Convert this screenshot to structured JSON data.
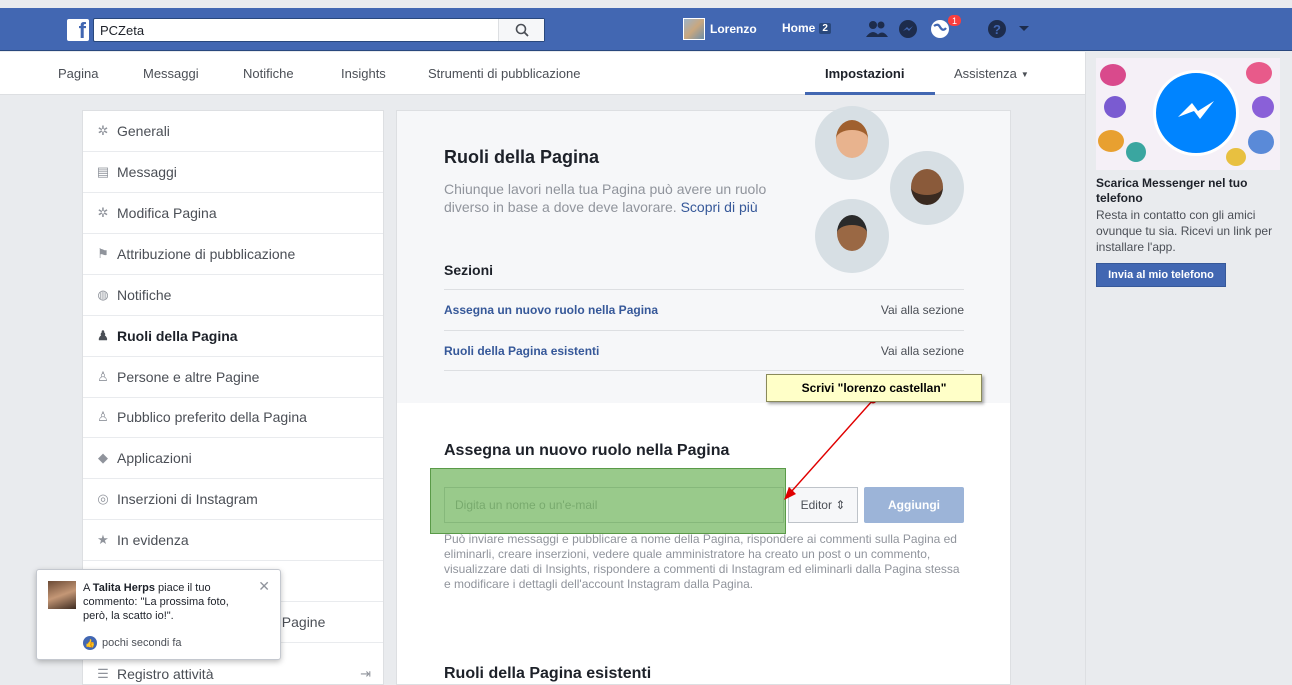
{
  "topbar": {
    "search_value": "PCZeta",
    "profile_name": "Lorenzo",
    "home_label": "Home",
    "home_count": "2",
    "notif_count": "1"
  },
  "pagenav": {
    "items": [
      "Pagina",
      "Messaggi",
      "Notifiche",
      "Insights",
      "Strumenti di pubblicazione",
      "Impostazioni",
      "Assistenza"
    ]
  },
  "leftmenu": {
    "items": [
      {
        "label": "Generali",
        "icon": "gear-icon"
      },
      {
        "label": "Messaggi",
        "icon": "messages-icon"
      },
      {
        "label": "Modifica Pagina",
        "icon": "gear-icon"
      },
      {
        "label": "Attribuzione di pubblicazione",
        "icon": "flag-icon"
      },
      {
        "label": "Notifiche",
        "icon": "globe-icon"
      },
      {
        "label": "Ruoli della Pagina",
        "icon": "person-icon"
      },
      {
        "label": "Persone e altre Pagine",
        "icon": "person-plus-icon"
      },
      {
        "label": "Pubblico preferito della Pagina",
        "icon": "person-plus-icon"
      },
      {
        "label": "Applicazioni",
        "icon": "cube-icon"
      },
      {
        "label": "Inserzioni di Instagram",
        "icon": "instagram-icon"
      },
      {
        "label": "In evidenza",
        "icon": "star-icon"
      },
      {
        "label": "",
        "icon": ""
      },
      {
        "label": "le Pagine",
        "icon": ""
      },
      {
        "label": "Registro attività",
        "icon": "list-icon"
      }
    ]
  },
  "main": {
    "title": "Ruoli della Pagina",
    "description": "Chiunque lavori nella tua Pagina può avere un ruolo diverso in base a dove deve lavorare.",
    "learn_more": "Scopri di più",
    "sections_title": "Sezioni",
    "sections": [
      {
        "label": "Assegna un nuovo ruolo nella Pagina",
        "action": "Vai alla sezione"
      },
      {
        "label": "Ruoli della Pagina esistenti",
        "action": "Vai alla sezione"
      }
    ],
    "assign_title": "Assegna un nuovo ruolo nella Pagina",
    "input_placeholder": "Digita un nome o un'e-mail",
    "role_select": "Editor",
    "add_button": "Aggiungi",
    "help_text": "Può inviare messaggi e pubblicare a nome della Pagina, rispondere ai commenti sulla Pagina ed eliminarli, creare inserzioni, vedere quale amministratore ha creato un post o un commento, visualizzare dati di Insights, rispondere a commenti di Instagram ed eliminarli dalla Pagina stessa e modificare i dettagli dell'account Instagram dalla Pagina.",
    "existing_title": "Ruoli della Pagina esistenti"
  },
  "tooltip": {
    "text": "Scrivi \"lorenzo castellan\""
  },
  "ad": {
    "title": "Scarica Messenger nel tuo telefono",
    "body": "Resta in contatto con gli amici ovunque tu sia. Ricevi un link per installare l'app.",
    "button": "Invia al mio telefono"
  },
  "popup": {
    "prefix": "A ",
    "user": "Talita Herps",
    "text": " piace il tuo commento: \"La prossima foto, però, la scatto io!\".",
    "time": "pochi secondi fa"
  },
  "colors": {
    "brand_blue": "#4267b2",
    "highlight_green": "#6eb45a",
    "tooltip_yellow": "#ffffc8",
    "arrow_red": "#e00000"
  }
}
